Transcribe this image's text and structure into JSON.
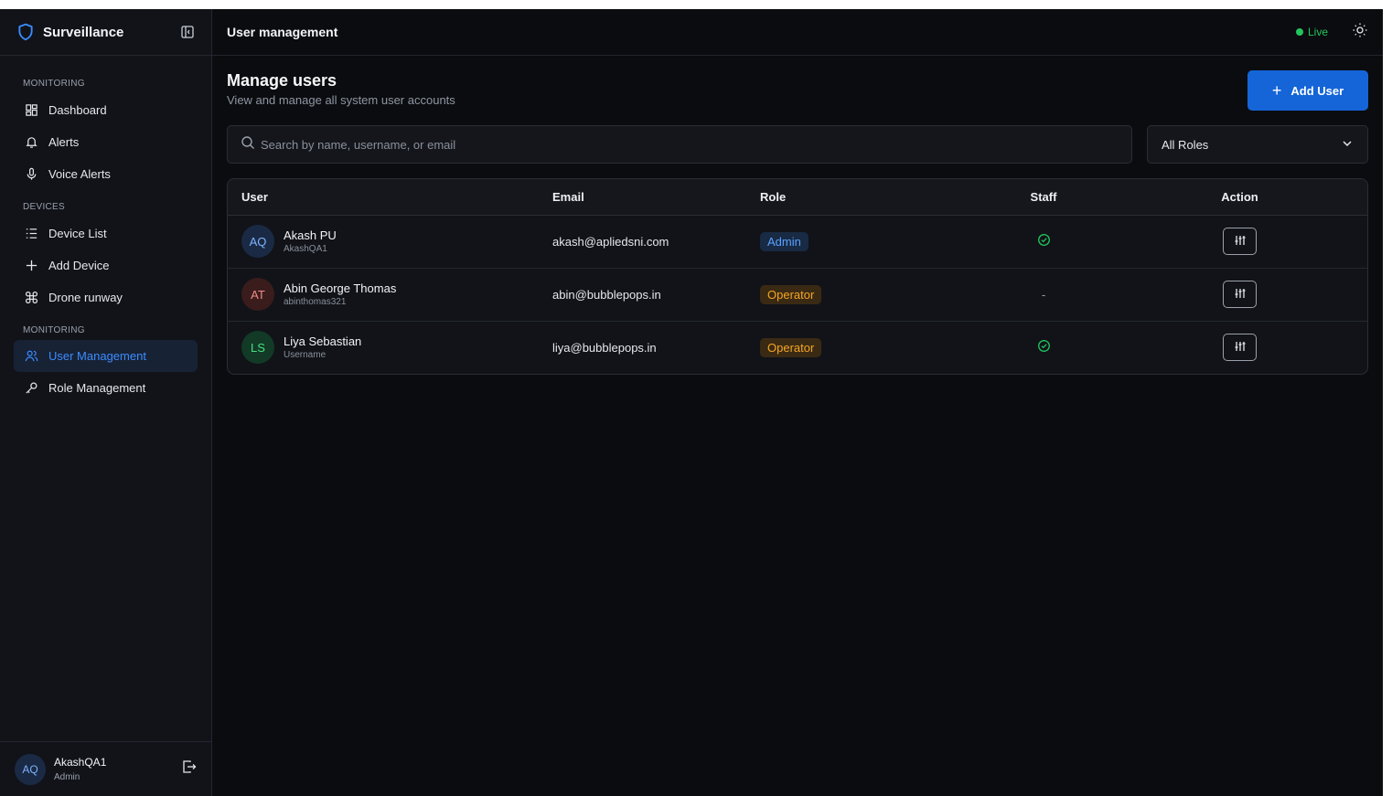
{
  "brand": {
    "name": "Surveillance",
    "logo_icon": "shield-icon",
    "collapse_icon": "sidebar-collapse-icon"
  },
  "sidebar": {
    "sections": [
      {
        "label": "MONITORING",
        "items": [
          {
            "label": "Dashboard",
            "icon": "dashboard-icon"
          },
          {
            "label": "Alerts",
            "icon": "bell-icon"
          },
          {
            "label": "Voice Alerts",
            "icon": "microphone-icon"
          }
        ]
      },
      {
        "label": "DEVICES",
        "items": [
          {
            "label": "Device List",
            "icon": "list-icon"
          },
          {
            "label": "Add Device",
            "icon": "plus-icon"
          },
          {
            "label": "Drone runway",
            "icon": "drone-icon"
          }
        ]
      },
      {
        "label": "MONITORING",
        "items": [
          {
            "label": "User Management",
            "icon": "users-icon",
            "active": true
          },
          {
            "label": "Role Management",
            "icon": "key-icon"
          }
        ]
      }
    ],
    "current_user": {
      "initials": "AQ",
      "name": "AkashQA1",
      "role": "Admin",
      "logout_icon": "logout-icon"
    }
  },
  "topbar": {
    "title": "User management",
    "status": "Live",
    "theme_icon": "sun-icon"
  },
  "page": {
    "title": "Manage users",
    "subtitle": "View and manage all system user accounts",
    "add_button": "Add User",
    "search_placeholder": "Search by name, username, or email",
    "role_filter": "All Roles"
  },
  "table": {
    "columns": [
      "User",
      "Email",
      "Role",
      "Staff",
      "Action"
    ],
    "rows": [
      {
        "initials": "AQ",
        "name": "Akash PU",
        "username": "AkashQA1",
        "email": "akash@apliedsni.com",
        "role": "Admin",
        "staff": true
      },
      {
        "initials": "AT",
        "name": "Abin George Thomas",
        "username": "abinthomas321",
        "email": "abin@bubblepops.in",
        "role": "Operator",
        "staff": false,
        "staff_text": "-"
      },
      {
        "initials": "LS",
        "name": "Liya Sebastian",
        "username": "Username",
        "email": "liya@bubblepops.in",
        "role": "Operator",
        "staff": true
      }
    ]
  },
  "colors": {
    "accent": "#1565d8",
    "live": "#22c55e",
    "admin_badge": "#5aa2ff",
    "operator_badge": "#f5a524"
  }
}
